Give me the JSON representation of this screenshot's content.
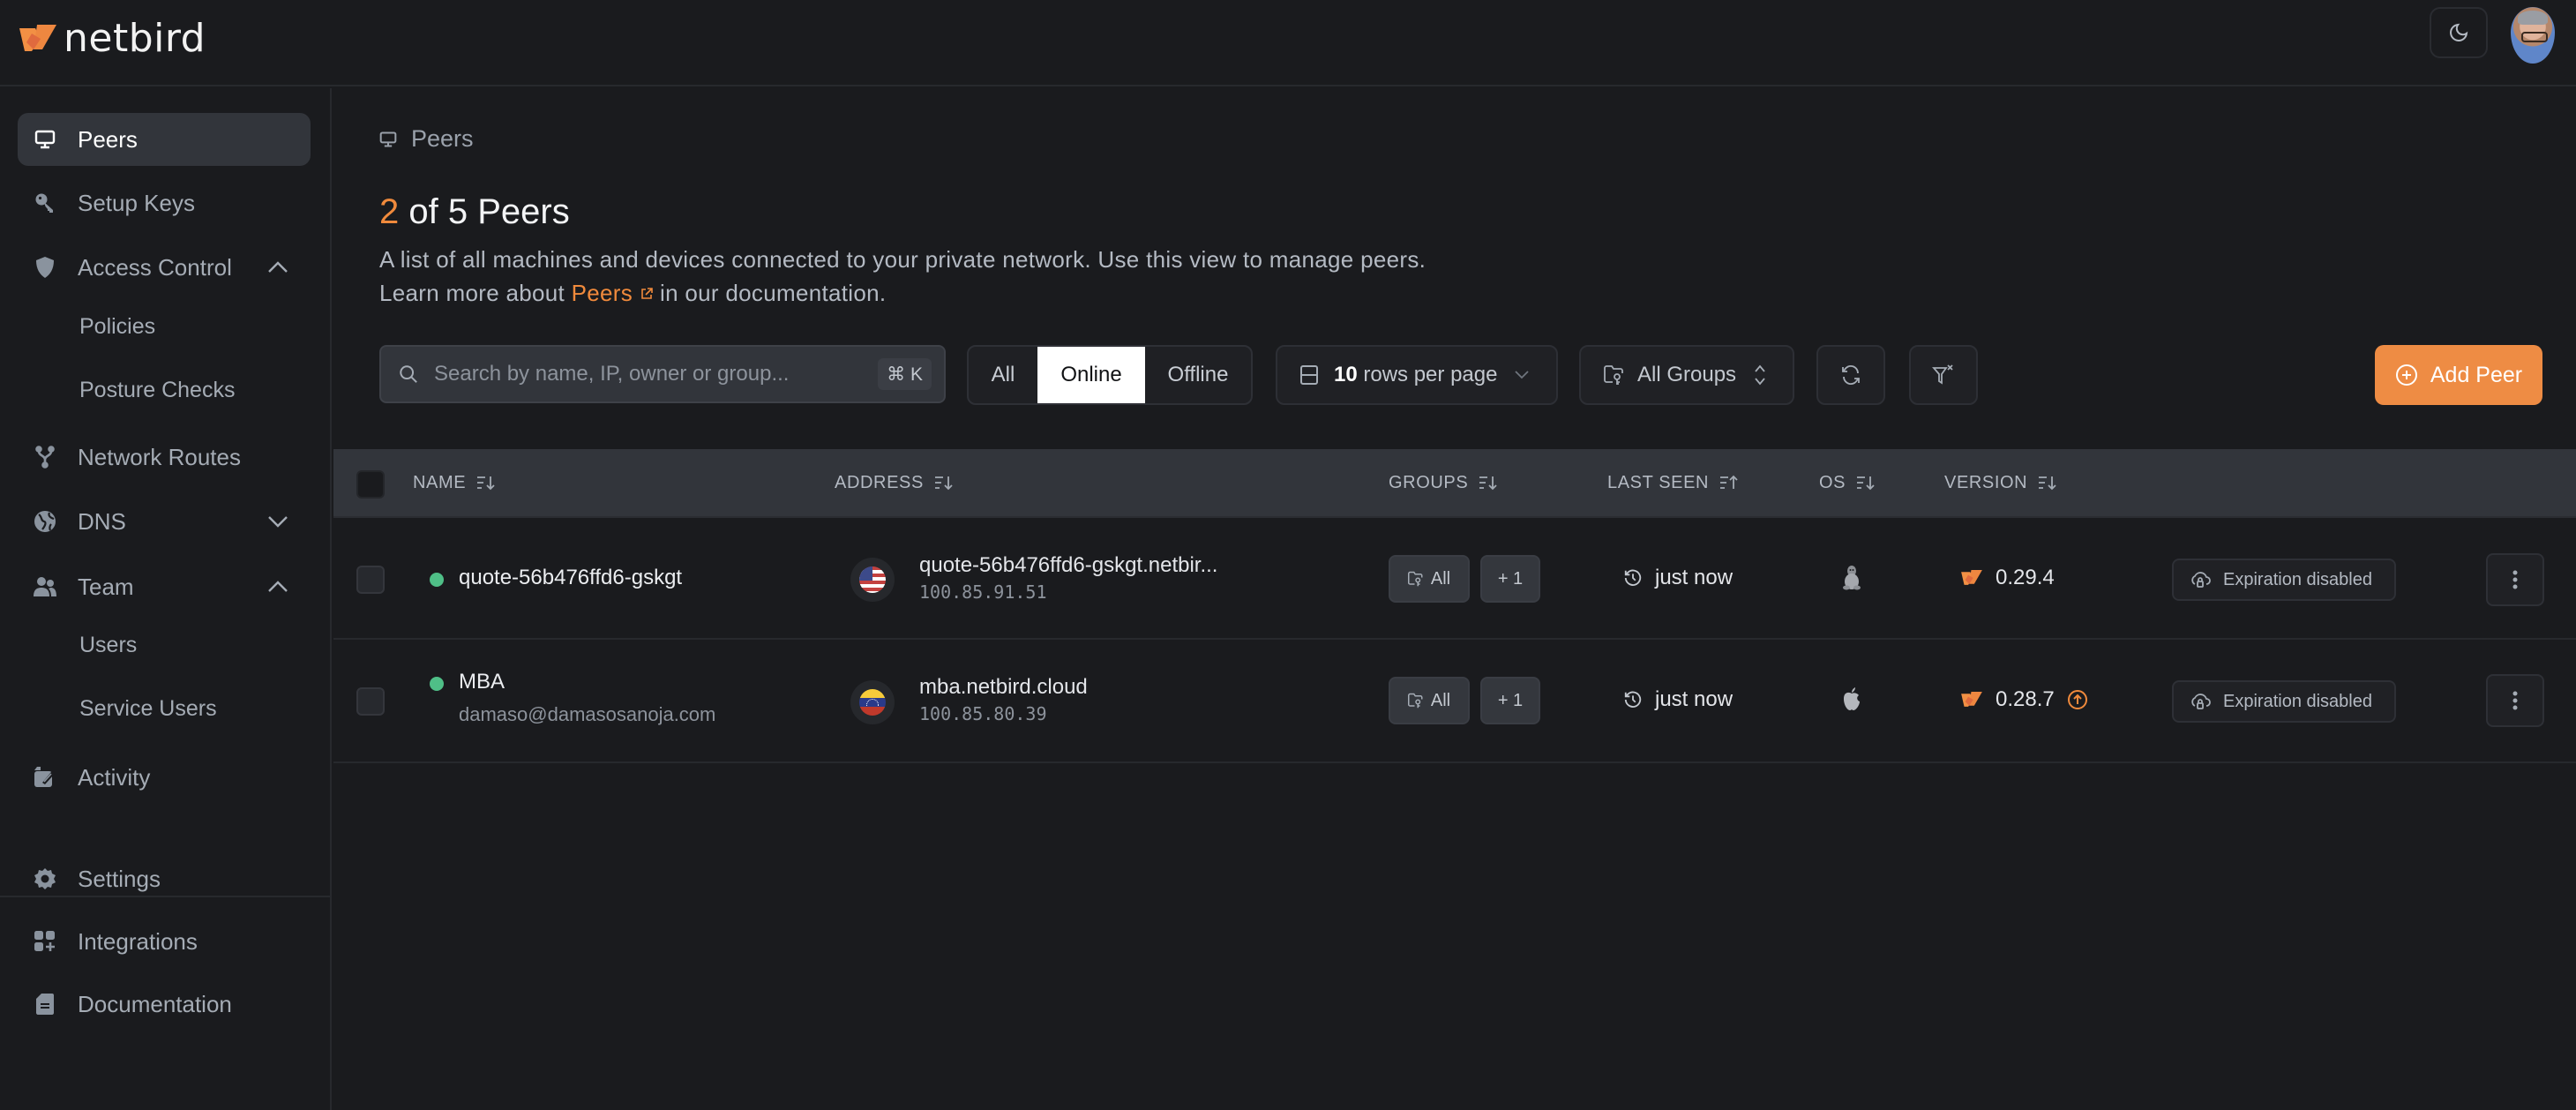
{
  "app": {
    "brand": "netbird",
    "brand_color": "#f08a3c"
  },
  "topbar": {
    "theme_toggle_icon": "moon-icon",
    "avatar_alt": "user-avatar"
  },
  "sidebar": {
    "items": [
      {
        "label": "Peers",
        "icon": "monitor-icon",
        "active": true
      },
      {
        "label": "Setup Keys",
        "icon": "key-icon"
      },
      {
        "label": "Access Control",
        "icon": "shield-icon",
        "expanded": true
      },
      {
        "label": "Policies",
        "sub": true
      },
      {
        "label": "Posture Checks",
        "sub": true
      },
      {
        "label": "Network Routes",
        "icon": "network-icon"
      },
      {
        "label": "DNS",
        "icon": "globe-icon",
        "expanded": false
      },
      {
        "label": "Team",
        "icon": "users-icon",
        "expanded": true
      },
      {
        "label": "Users",
        "sub": true
      },
      {
        "label": "Service Users",
        "sub": true
      },
      {
        "label": "Activity",
        "icon": "activity-icon"
      },
      {
        "label": "Settings",
        "icon": "gear-icon"
      },
      {
        "label": "Integrations",
        "icon": "integrations-icon"
      },
      {
        "label": "Documentation",
        "icon": "document-icon"
      }
    ]
  },
  "main": {
    "breadcrumb": "Peers",
    "title": {
      "count": "2",
      "rest": " of 5 Peers"
    },
    "description_line1": "A list of all machines and devices connected to your private network. Use this view to manage peers.",
    "description_prefix": "Learn more about ",
    "description_link": "Peers",
    "description_suffix": " in our documentation.",
    "search": {
      "placeholder": "Search by name, IP, owner or group...",
      "value": "",
      "shortcut": "⌘ K"
    },
    "filter_tabs": [
      {
        "label": "All",
        "active": false
      },
      {
        "label": "Online",
        "active": true
      },
      {
        "label": "Offline",
        "active": false
      }
    ],
    "rows_per_page": {
      "count": "10",
      "label": " rows per page"
    },
    "groups_filter": "All Groups",
    "add_peer": "Add Peer"
  },
  "table": {
    "columns": [
      "NAME",
      "ADDRESS",
      "GROUPS",
      "LAST SEEN",
      "OS",
      "VERSION"
    ],
    "rows": [
      {
        "name": "quote-56b476ffd6-gskgt",
        "user": "",
        "status": "online",
        "flag": "us",
        "dns": "quote-56b476ffd6-gskgt.netbir...",
        "ip": "100.85.91.51",
        "groups": [
          "All",
          "+ 1"
        ],
        "last_seen": "just now",
        "os": "linux",
        "version": "0.29.4",
        "update_available": false,
        "expiration": "Expiration disabled"
      },
      {
        "name": "MBA",
        "user": "damaso@damasosanoja.com",
        "status": "online",
        "flag": "ve",
        "dns": "mba.netbird.cloud",
        "ip": "100.85.80.39",
        "groups": [
          "All",
          "+ 1"
        ],
        "last_seen": "just now",
        "os": "macos",
        "version": "0.28.7",
        "update_available": true,
        "expiration": "Expiration disabled"
      }
    ]
  }
}
